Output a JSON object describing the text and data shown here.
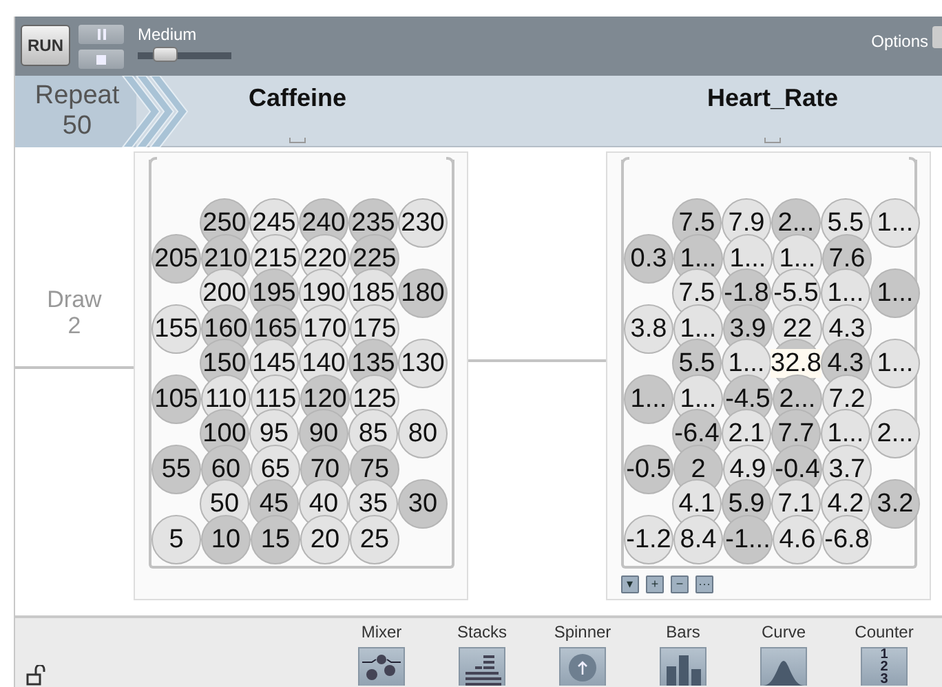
{
  "toolbar": {
    "run_label": "RUN",
    "speed": {
      "label": "Medium",
      "level": 0.3
    },
    "options_label": "Options"
  },
  "repeat": {
    "label": "Repeat",
    "count": "50"
  },
  "draw": {
    "label": "Draw",
    "count": "2"
  },
  "devices": [
    {
      "attribute": "Caffeine",
      "rows": [
        [
          {
            "value": "250",
            "shaded": true,
            "selected": false
          },
          {
            "value": "245",
            "shaded": false,
            "selected": false
          },
          {
            "value": "240",
            "shaded": true,
            "selected": false
          },
          {
            "value": "235",
            "shaded": true,
            "selected": false
          },
          {
            "value": "230",
            "shaded": false,
            "selected": false
          }
        ],
        [
          {
            "value": "205",
            "shaded": true,
            "selected": false
          },
          {
            "value": "210",
            "shaded": true,
            "selected": false
          },
          {
            "value": "215",
            "shaded": false,
            "selected": false
          },
          {
            "value": "220",
            "shaded": false,
            "selected": false
          },
          {
            "value": "225",
            "shaded": true,
            "selected": false
          }
        ],
        [
          {
            "value": "200",
            "shaded": false,
            "selected": false
          },
          {
            "value": "195",
            "shaded": true,
            "selected": false
          },
          {
            "value": "190",
            "shaded": false,
            "selected": false
          },
          {
            "value": "185",
            "shaded": false,
            "selected": false
          },
          {
            "value": "180",
            "shaded": true,
            "selected": false
          }
        ],
        [
          {
            "value": "155",
            "shaded": false,
            "selected": false
          },
          {
            "value": "160",
            "shaded": true,
            "selected": false
          },
          {
            "value": "165",
            "shaded": true,
            "selected": false
          },
          {
            "value": "170",
            "shaded": false,
            "selected": false
          },
          {
            "value": "175",
            "shaded": false,
            "selected": false
          }
        ],
        [
          {
            "value": "150",
            "shaded": true,
            "selected": false
          },
          {
            "value": "145",
            "shaded": false,
            "selected": false
          },
          {
            "value": "140",
            "shaded": false,
            "selected": false
          },
          {
            "value": "135",
            "shaded": true,
            "selected": false
          },
          {
            "value": "130",
            "shaded": false,
            "selected": false
          }
        ],
        [
          {
            "value": "105",
            "shaded": true,
            "selected": false
          },
          {
            "value": "110",
            "shaded": false,
            "selected": false
          },
          {
            "value": "115",
            "shaded": false,
            "selected": false
          },
          {
            "value": "120",
            "shaded": true,
            "selected": false
          },
          {
            "value": "125",
            "shaded": false,
            "selected": false
          }
        ],
        [
          {
            "value": "100",
            "shaded": true,
            "selected": false
          },
          {
            "value": "95",
            "shaded": false,
            "selected": false
          },
          {
            "value": "90",
            "shaded": true,
            "selected": false
          },
          {
            "value": "85",
            "shaded": false,
            "selected": false
          },
          {
            "value": "80",
            "shaded": false,
            "selected": false
          }
        ],
        [
          {
            "value": "55",
            "shaded": true,
            "selected": false
          },
          {
            "value": "60",
            "shaded": true,
            "selected": false
          },
          {
            "value": "65",
            "shaded": false,
            "selected": false
          },
          {
            "value": "70",
            "shaded": true,
            "selected": false
          },
          {
            "value": "75",
            "shaded": true,
            "selected": false
          }
        ],
        [
          {
            "value": "50",
            "shaded": false,
            "selected": false
          },
          {
            "value": "45",
            "shaded": true,
            "selected": false
          },
          {
            "value": "40",
            "shaded": false,
            "selected": false
          },
          {
            "value": "35",
            "shaded": false,
            "selected": false
          },
          {
            "value": "30",
            "shaded": true,
            "selected": false
          }
        ],
        [
          {
            "value": "5",
            "shaded": false,
            "selected": false
          },
          {
            "value": "10",
            "shaded": true,
            "selected": false
          },
          {
            "value": "15",
            "shaded": true,
            "selected": false
          },
          {
            "value": "20",
            "shaded": false,
            "selected": false
          },
          {
            "value": "25",
            "shaded": false,
            "selected": false
          }
        ]
      ]
    },
    {
      "attribute": "Heart_Rate",
      "rows": [
        [
          {
            "value": "7.5",
            "shaded": true,
            "selected": false
          },
          {
            "value": "7.9",
            "shaded": false,
            "selected": false
          },
          {
            "value": "2...",
            "shaded": true,
            "selected": false
          },
          {
            "value": "5.5",
            "shaded": false,
            "selected": false
          },
          {
            "value": "1...",
            "shaded": false,
            "selected": false
          }
        ],
        [
          {
            "value": "0.3",
            "shaded": true,
            "selected": false
          },
          {
            "value": "1...",
            "shaded": true,
            "selected": false
          },
          {
            "value": "1...",
            "shaded": false,
            "selected": false
          },
          {
            "value": "1...",
            "shaded": false,
            "selected": false
          },
          {
            "value": "7.6",
            "shaded": true,
            "selected": false
          }
        ],
        [
          {
            "value": "7.5",
            "shaded": false,
            "selected": false
          },
          {
            "value": "-1.8",
            "shaded": true,
            "selected": false
          },
          {
            "value": "-5.5",
            "shaded": false,
            "selected": false
          },
          {
            "value": "1...",
            "shaded": false,
            "selected": false
          },
          {
            "value": "1...",
            "shaded": true,
            "selected": false
          }
        ],
        [
          {
            "value": "3.8",
            "shaded": false,
            "selected": false
          },
          {
            "value": "1...",
            "shaded": false,
            "selected": false
          },
          {
            "value": "3.9",
            "shaded": true,
            "selected": false
          },
          {
            "value": "22",
            "shaded": false,
            "selected": false
          },
          {
            "value": "4.3",
            "shaded": false,
            "selected": false
          }
        ],
        [
          {
            "value": "5.5",
            "shaded": true,
            "selected": false
          },
          {
            "value": "1...",
            "shaded": false,
            "selected": false
          },
          {
            "value": "32.8",
            "shaded": true,
            "selected": true
          },
          {
            "value": "4.3",
            "shaded": true,
            "selected": false
          },
          {
            "value": "1...",
            "shaded": false,
            "selected": false
          }
        ],
        [
          {
            "value": "1...",
            "shaded": true,
            "selected": false
          },
          {
            "value": "1...",
            "shaded": false,
            "selected": false
          },
          {
            "value": "-4.5",
            "shaded": true,
            "selected": false
          },
          {
            "value": "2...",
            "shaded": true,
            "selected": false
          },
          {
            "value": "7.2",
            "shaded": false,
            "selected": false
          }
        ],
        [
          {
            "value": "-6.4",
            "shaded": true,
            "selected": false
          },
          {
            "value": "2.1",
            "shaded": false,
            "selected": false
          },
          {
            "value": "7.7",
            "shaded": true,
            "selected": false
          },
          {
            "value": "1...",
            "shaded": false,
            "selected": false
          },
          {
            "value": "2...",
            "shaded": false,
            "selected": false
          }
        ],
        [
          {
            "value": "-0.5",
            "shaded": true,
            "selected": false
          },
          {
            "value": "2",
            "shaded": true,
            "selected": false
          },
          {
            "value": "4.9",
            "shaded": false,
            "selected": false
          },
          {
            "value": "-0.4",
            "shaded": true,
            "selected": false
          },
          {
            "value": "3.7",
            "shaded": false,
            "selected": false
          }
        ],
        [
          {
            "value": "4.1",
            "shaded": false,
            "selected": false
          },
          {
            "value": "5.9",
            "shaded": true,
            "selected": false
          },
          {
            "value": "7.1",
            "shaded": false,
            "selected": false
          },
          {
            "value": "4.2",
            "shaded": false,
            "selected": false
          },
          {
            "value": "3.2",
            "shaded": true,
            "selected": false
          }
        ],
        [
          {
            "value": "-1.2",
            "shaded": false,
            "selected": false
          },
          {
            "value": "8.4",
            "shaded": false,
            "selected": false
          },
          {
            "value": "-1...",
            "shaded": true,
            "selected": false
          },
          {
            "value": "4.6",
            "shaded": false,
            "selected": false
          },
          {
            "value": "-6.8",
            "shaded": false,
            "selected": false
          }
        ]
      ],
      "controls": [
        "▾",
        "+",
        "−",
        "···"
      ]
    }
  ],
  "palette": [
    {
      "label": "Mixer",
      "kind": "mixer"
    },
    {
      "label": "Stacks",
      "kind": "stacks"
    },
    {
      "label": "Spinner",
      "kind": "spinner"
    },
    {
      "label": "Bars",
      "kind": "bars"
    },
    {
      "label": "Curve",
      "kind": "curve"
    },
    {
      "label": "Counter",
      "kind": "counter",
      "digits": [
        "1",
        "2",
        "3"
      ]
    }
  ]
}
